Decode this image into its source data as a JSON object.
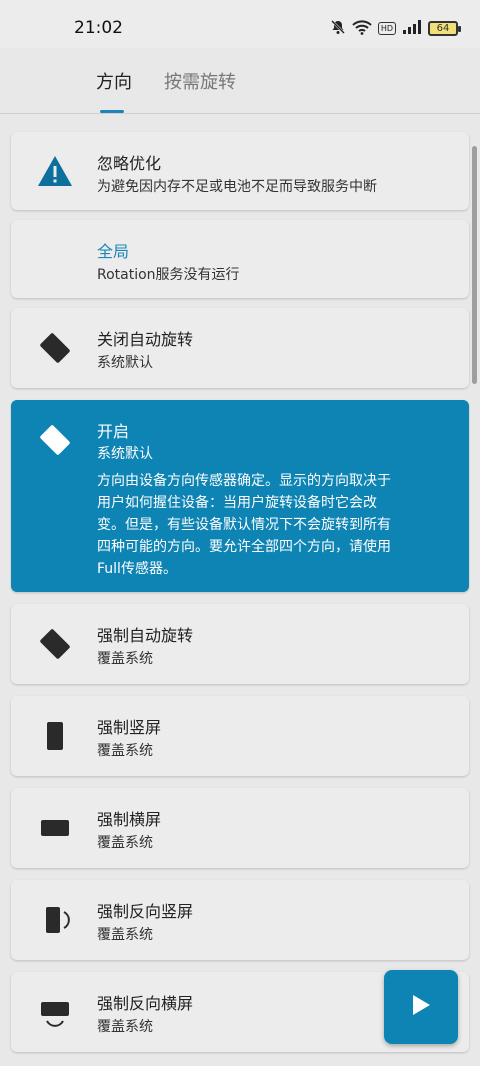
{
  "status_bar": {
    "time": "21:02",
    "icons": [
      "mute-icon",
      "wifi-icon",
      "hd-icon",
      "signal-icon",
      "battery-icon"
    ],
    "hd_label": "HD",
    "battery_level": "64"
  },
  "tabs": [
    {
      "label": "方向",
      "active": true
    },
    {
      "label": "按需旋转",
      "active": false
    }
  ],
  "cards": [
    {
      "title": "忽略优化",
      "subtitle": "为避免因内存不足或电池不足而导致服务中断",
      "icon": "warning-icon"
    },
    {
      "title": "全局",
      "subtitle": "Rotation服务没有运行",
      "icon": ""
    },
    {
      "title": "关闭自动旋转",
      "subtitle": "系统默认",
      "icon": "rotate-off-icon"
    },
    {
      "title": "开启",
      "subtitle": "系统默认",
      "icon": "rotate-on-icon",
      "description": [
        "方向由设备方向传感器确定。显示的方向取决于",
        "用户如何握住设备：当用户旋转设备时它会改",
        "变。但是，有些设备默认情况下不会旋转到所有",
        "四种可能的方向。要允许全部四个方向，请使用",
        "Full传感器。"
      ]
    },
    {
      "title": "强制自动旋转",
      "subtitle": "覆盖系统",
      "icon": "force-rotate-icon"
    },
    {
      "title": "强制竖屏",
      "subtitle": "覆盖系统",
      "icon": "portrait-icon"
    },
    {
      "title": "强制横屏",
      "subtitle": "覆盖系统",
      "icon": "landscape-icon"
    },
    {
      "title": "强制反向竖屏",
      "subtitle": "覆盖系统",
      "icon": "reverse-portrait-icon"
    },
    {
      "title": "强制反向横屏",
      "subtitle": "覆盖系统",
      "icon": "reverse-landscape-icon"
    }
  ],
  "fab": {
    "icon": "play-icon"
  },
  "colors": {
    "accent": "#0d84b4",
    "background": "#e8e8e8",
    "card": "#ececec"
  }
}
